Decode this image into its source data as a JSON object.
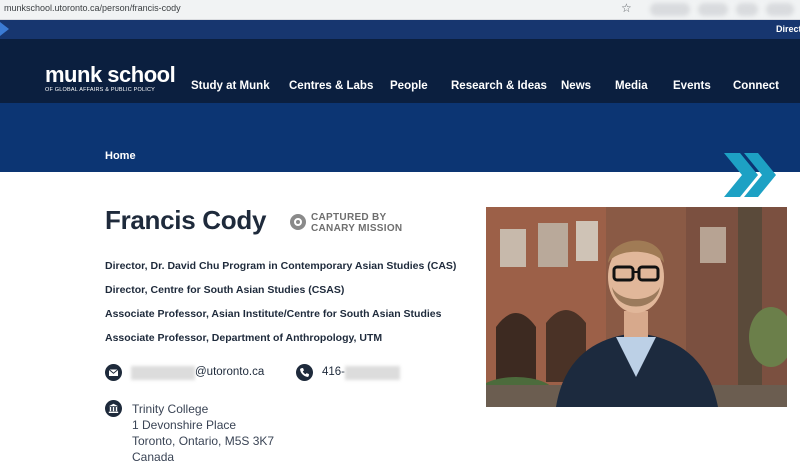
{
  "browser": {
    "url": "munkschool.utoronto.ca/person/francis-cody"
  },
  "utility_bar": {
    "link": "Directo"
  },
  "logo": {
    "brand": "munk school",
    "subtitle": "OF GLOBAL AFFAIRS & PUBLIC POLICY"
  },
  "nav": {
    "items": [
      "Study at Munk",
      "Centres & Labs",
      "People",
      "Research & Ideas",
      "News",
      "Media",
      "Events",
      "Connect"
    ]
  },
  "breadcrumb": {
    "home": "Home"
  },
  "profile": {
    "name": "Francis Cody",
    "badge_line1": "CAPTURED BY",
    "badge_line2": "CANARY MISSION",
    "titles": [
      "Director, Dr. David Chu Program in Contemporary Asian Studies (CAS)",
      "Director, Centre for South Asian Studies (CSAS)",
      "Associate Professor, Asian Institute/Centre for South Asian Studies",
      "Associate Professor, Department of Anthropology, UTM"
    ],
    "email_domain": "@utoronto.ca",
    "phone_prefix": "416-",
    "address": [
      "Trinity College",
      "1 Devonshire Place",
      "Toronto, Ontario, M5S 3K7",
      "Canada"
    ]
  },
  "icons": {
    "email": "mail-icon",
    "phone": "phone-icon",
    "address": "building-icon",
    "badge": "canary-mission-logo-icon",
    "bookmark": "star-icon"
  },
  "colors": {
    "utility_bar": "#17366f",
    "nav_bg": "#0b1f3f",
    "hero_bg": "#0c3573",
    "text_dark": "#1e2a3b",
    "accent": "#1da1c4"
  }
}
